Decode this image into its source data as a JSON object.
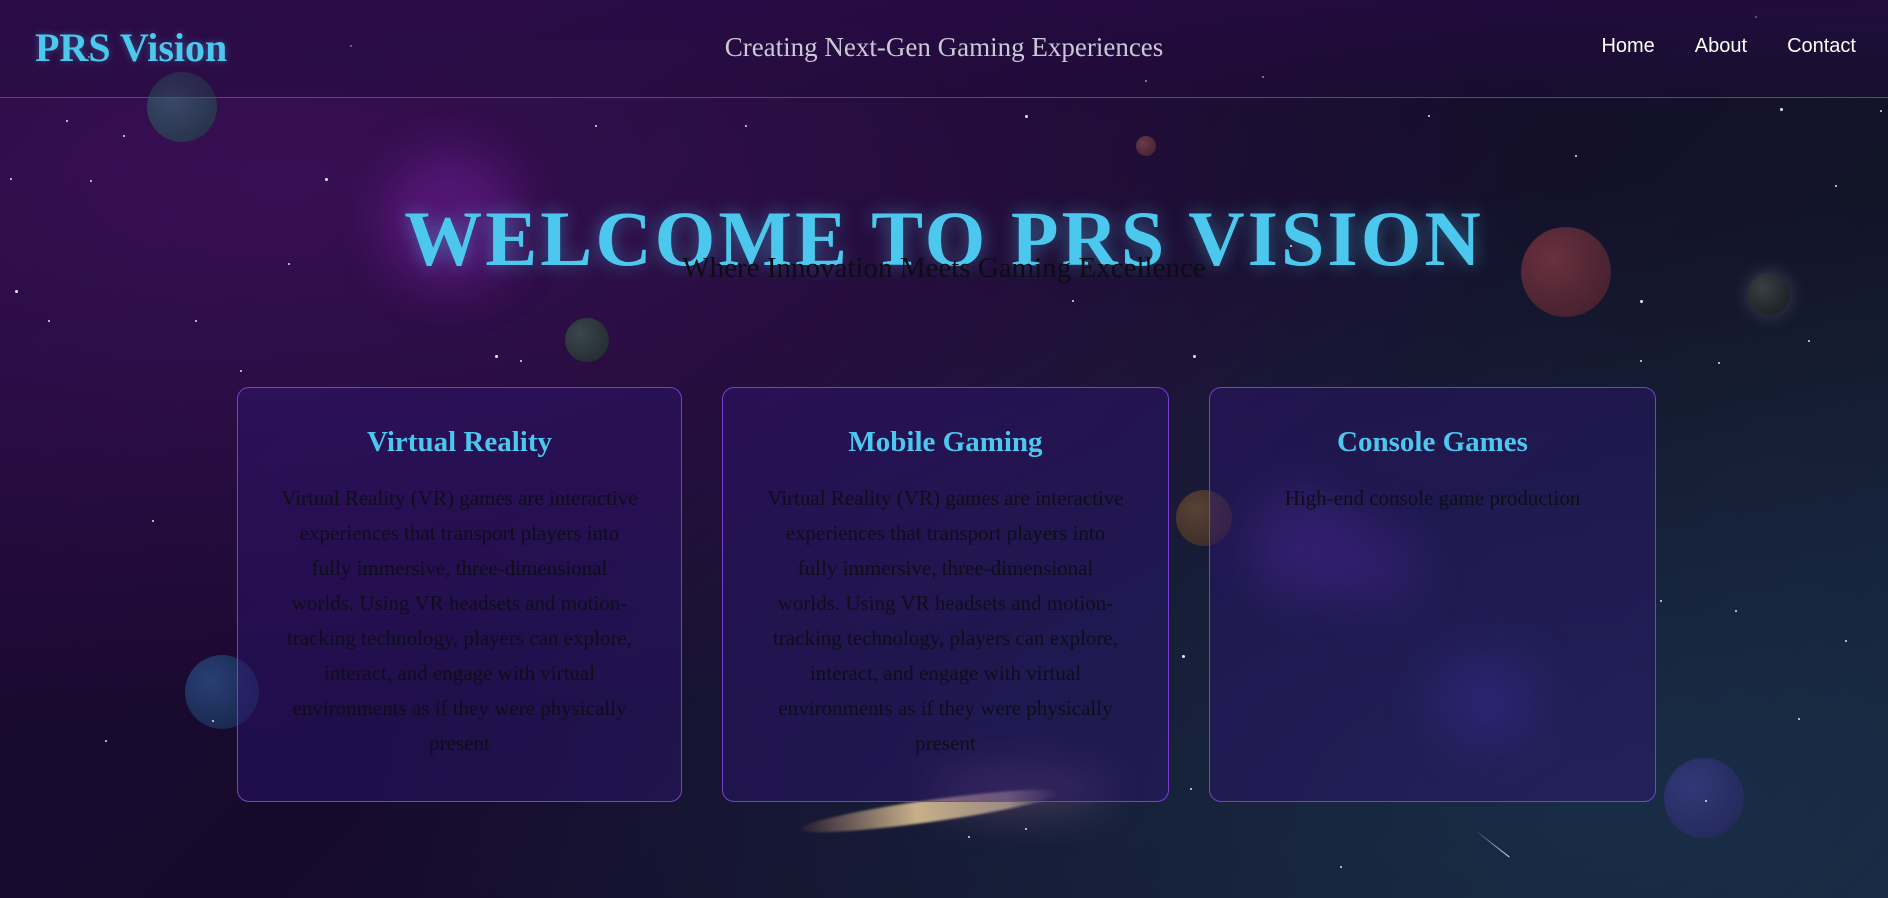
{
  "header": {
    "logo": "PRS Vision",
    "tagline": "Creating Next-Gen Gaming Experiences",
    "nav": [
      {
        "label": "Home"
      },
      {
        "label": "About"
      },
      {
        "label": "Contact"
      }
    ]
  },
  "hero": {
    "title": "WELCOME TO PRS VISION",
    "subtitle": "Where Innovation Meets Gaming Excellence"
  },
  "cards": [
    {
      "title": "Virtual Reality",
      "text": "Virtual Reality (VR) games are interactive experiences that transport players into fully immersive, three-dimensional worlds. Using VR headsets and motion-tracking technology, players can explore, interact, and engage with virtual environments as if they were physically present"
    },
    {
      "title": "Mobile Gaming",
      "text": "Virtual Reality (VR) games are interactive experiences that transport players into fully immersive, three-dimensional worlds. Using VR headsets and motion-tracking technology, players can explore, interact, and engage with virtual environments as if they were physically present"
    },
    {
      "title": "Console Games",
      "text": "High-end console game production"
    }
  ],
  "colors": {
    "accent": "#4cc8ee",
    "border": "#7a3ed0",
    "background": "#160a2c"
  }
}
